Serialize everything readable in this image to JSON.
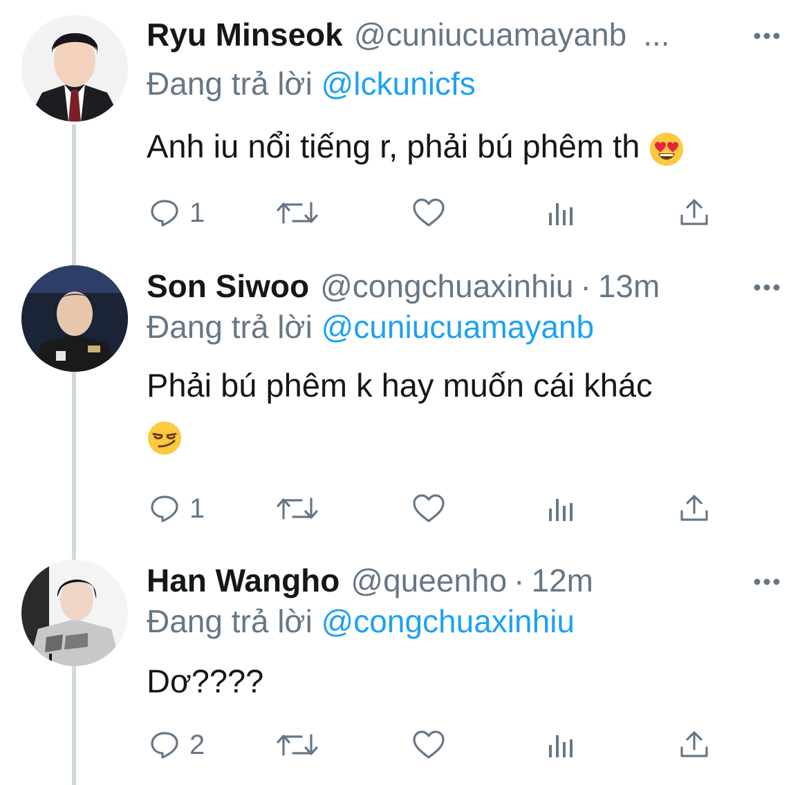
{
  "thread": [
    {
      "name": "Ryu Minseok",
      "handle": "@cuniucuamayanb",
      "time": "...",
      "reply_label": "Đang trả lời",
      "reply_to": "@lckunicfs",
      "text": "Anh iu nổi tiếng r, phải bú phêm th",
      "emoji": "heart-eyes-emoji",
      "replies": "1"
    },
    {
      "name": "Son Siwoo",
      "handle": "@congchuaxinhiu",
      "time": "13m",
      "reply_label": "Đang trả lời",
      "reply_to": "@cuniucuamayanb",
      "text": "Phải bú phêm k hay muốn cái khác",
      "emoji": "smirk-emoji",
      "replies": "1"
    },
    {
      "name": "Han Wangho",
      "handle": "@queenho",
      "time": "12m",
      "reply_label": "Đang trả lời",
      "reply_to": "@congchuaxinhiu",
      "text": "Dơ????",
      "replies": "2"
    }
  ],
  "colors": {
    "text": "#14171a",
    "secondary": "#657786",
    "link": "#1da1f2",
    "thread_line": "#cfd9de"
  }
}
